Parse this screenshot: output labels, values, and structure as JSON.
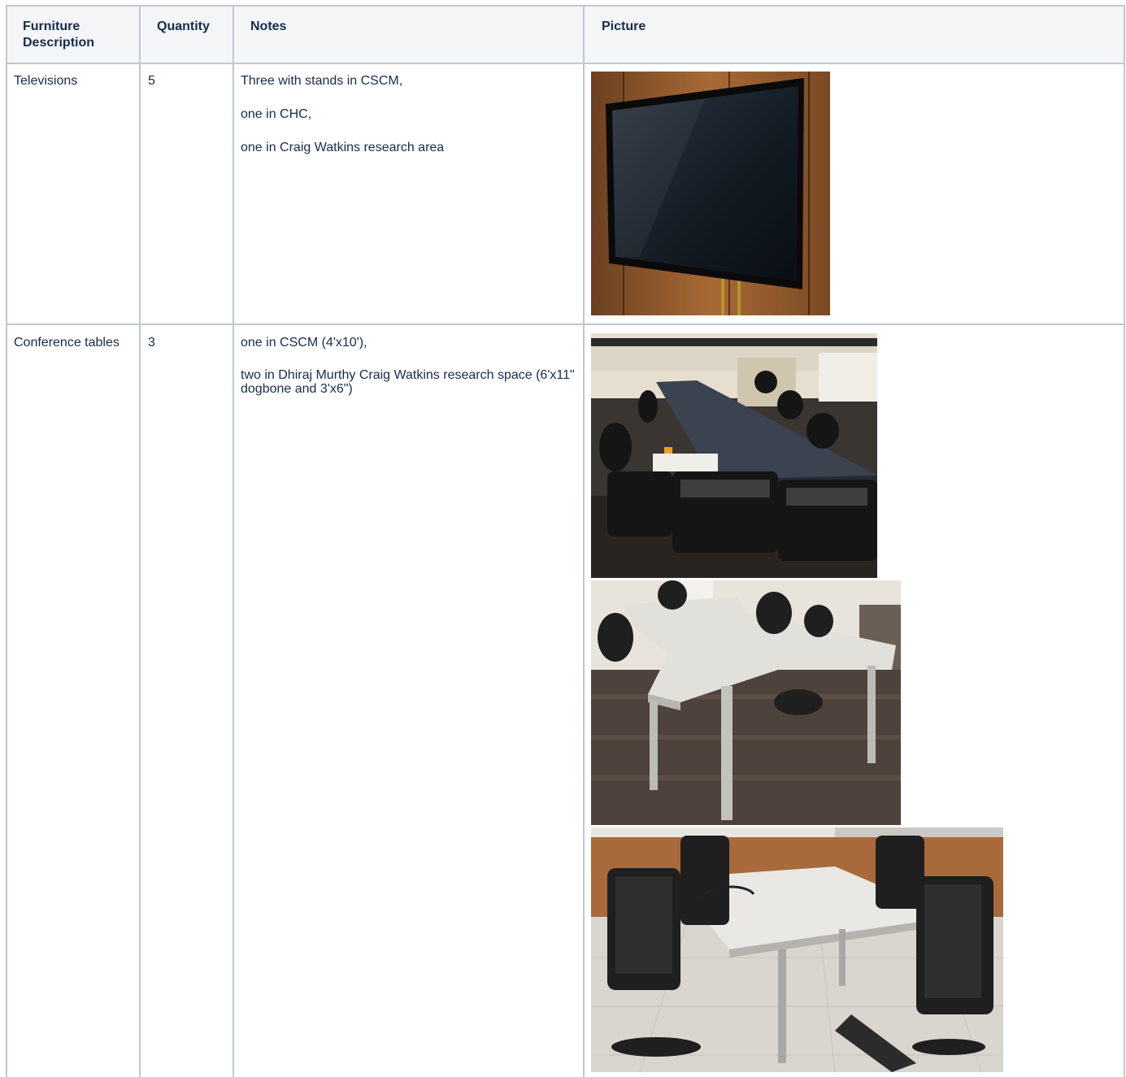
{
  "table": {
    "headers": [
      "Furniture Description",
      "Quantity",
      "Notes",
      "Picture"
    ],
    "rows": [
      {
        "description": "Televisions",
        "quantity": "5",
        "notes": [
          "Three with stands in CSCM,",
          "one in CHC,",
          "one in Craig Watkins research area"
        ],
        "pictures": [
          "wall-mounted-tv-photo"
        ]
      },
      {
        "description": "Conference tables",
        "quantity": "3",
        "notes": [
          "one in CSCM (4'x10'),",
          "two in Dhiraj Murthy Craig Watkins research space (6'x11\" dogbone and 3'x6\")"
        ],
        "pictures": [
          "dark-conference-table-photo",
          "dogbone-table-photo",
          "white-conference-table-photo"
        ]
      }
    ]
  },
  "colors": {
    "border": "#c1c7d0",
    "header_background": "#f4f5f7",
    "text": "#172b4d"
  }
}
